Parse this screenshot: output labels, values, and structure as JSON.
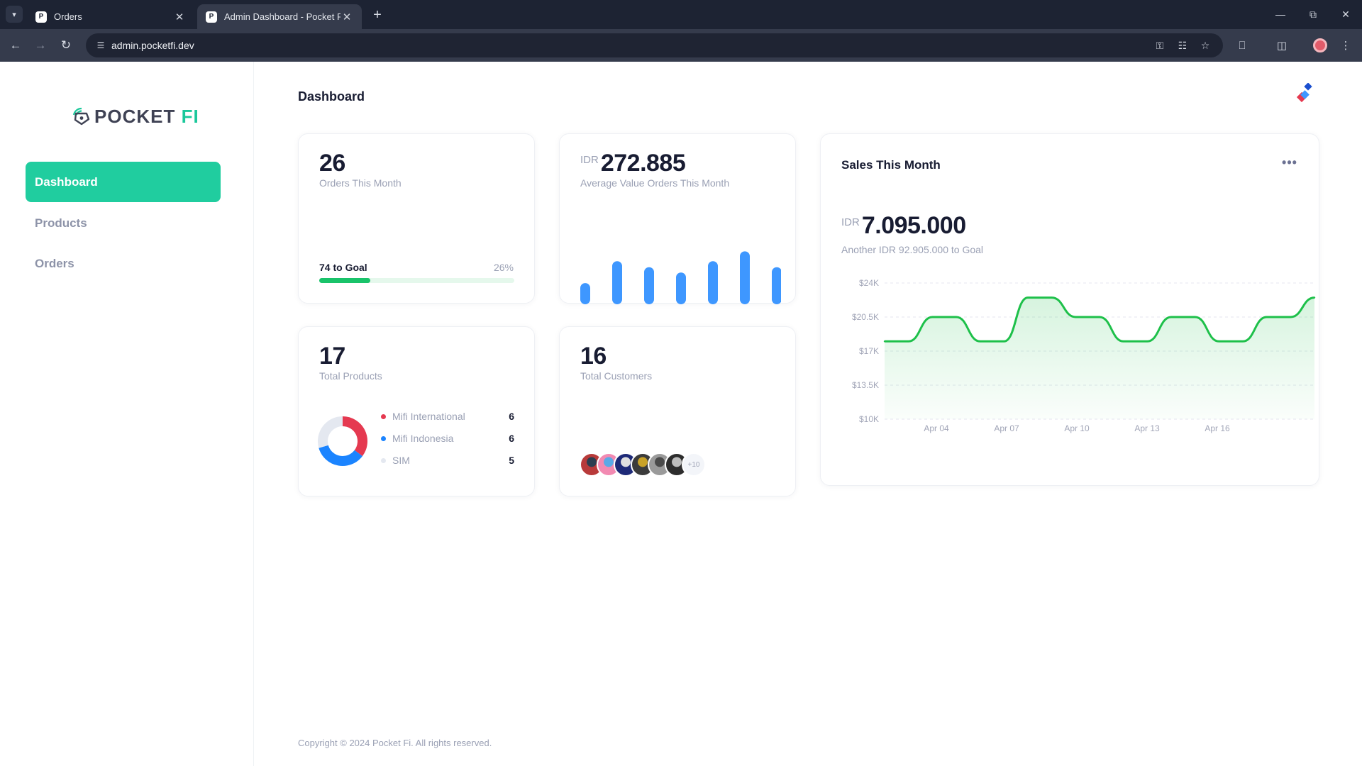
{
  "browser": {
    "tabs": [
      {
        "title": "Orders",
        "active": false
      },
      {
        "title": "Admin Dashboard - Pocket Fi",
        "active": true
      }
    ],
    "url": "admin.pocketfi.dev"
  },
  "sidebar": {
    "logo": {
      "main": "POCKET ",
      "accent": "FI"
    },
    "items": [
      {
        "label": "Dashboard",
        "active": true
      },
      {
        "label": "Products",
        "active": false
      },
      {
        "label": "Orders",
        "active": false
      }
    ]
  },
  "header": {
    "title": "Dashboard"
  },
  "orders_card": {
    "value": "26",
    "label": "Orders This Month",
    "goal_label": "74 to Goal",
    "goal_percent_label": "26%",
    "goal_fraction": 0.26,
    "progress_color": "#19c36a"
  },
  "avg_card": {
    "currency": "IDR",
    "value": "272.885",
    "label": "Average Value Orders This Month",
    "bar_color": "#3e97ff"
  },
  "products_card": {
    "value": "17",
    "label": "Total Products",
    "legend": [
      {
        "name": "Mifi International",
        "value": "6",
        "color": "#e53950"
      },
      {
        "name": "Mifi Indonesia",
        "value": "6",
        "color": "#1b84ff"
      },
      {
        "name": "SIM",
        "value": "5",
        "color": "#e4e8f0"
      }
    ]
  },
  "customers_card": {
    "value": "16",
    "label": "Total Customers",
    "more_label": "+10",
    "avatar_count": 6
  },
  "sales_card": {
    "title": "Sales This Month",
    "currency": "IDR",
    "value": "7.095.000",
    "subtitle": "Another IDR 92.905.000 to Goal",
    "line_color": "#1ec04a"
  },
  "footer": {
    "text": "Copyright © 2024 Pocket Fi. All rights reserved."
  },
  "chart_data": [
    {
      "type": "bar",
      "categories": [
        "1",
        "2",
        "3",
        "4",
        "5",
        "6",
        "7"
      ],
      "values": [
        28,
        57,
        49,
        42,
        57,
        70,
        49
      ],
      "ylim": [
        0,
        75
      ],
      "title": "",
      "xlabel": "",
      "ylabel": "",
      "grid": false
    },
    {
      "type": "pie",
      "categories": [
        "Mifi International",
        "Mifi Indonesia",
        "SIM"
      ],
      "values": [
        6,
        6,
        5
      ],
      "title": ""
    },
    {
      "type": "area",
      "title": "",
      "xlabel": "",
      "ylabel": "",
      "x_tick_labels": [
        "Apr 04",
        "Apr 07",
        "Apr 10",
        "Apr 13",
        "Apr 16"
      ],
      "y_tick_labels": [
        "$24K",
        "$20.5K",
        "$17K",
        "$13.5K",
        "$10K"
      ],
      "ylim": [
        10000,
        24000
      ],
      "grid": true,
      "values": [
        18000,
        18000,
        20500,
        20500,
        18000,
        18000,
        22500,
        22500,
        20500,
        20500,
        18000,
        18000,
        20500,
        20500,
        18000,
        18000,
        20500,
        20500,
        22500
      ]
    }
  ]
}
